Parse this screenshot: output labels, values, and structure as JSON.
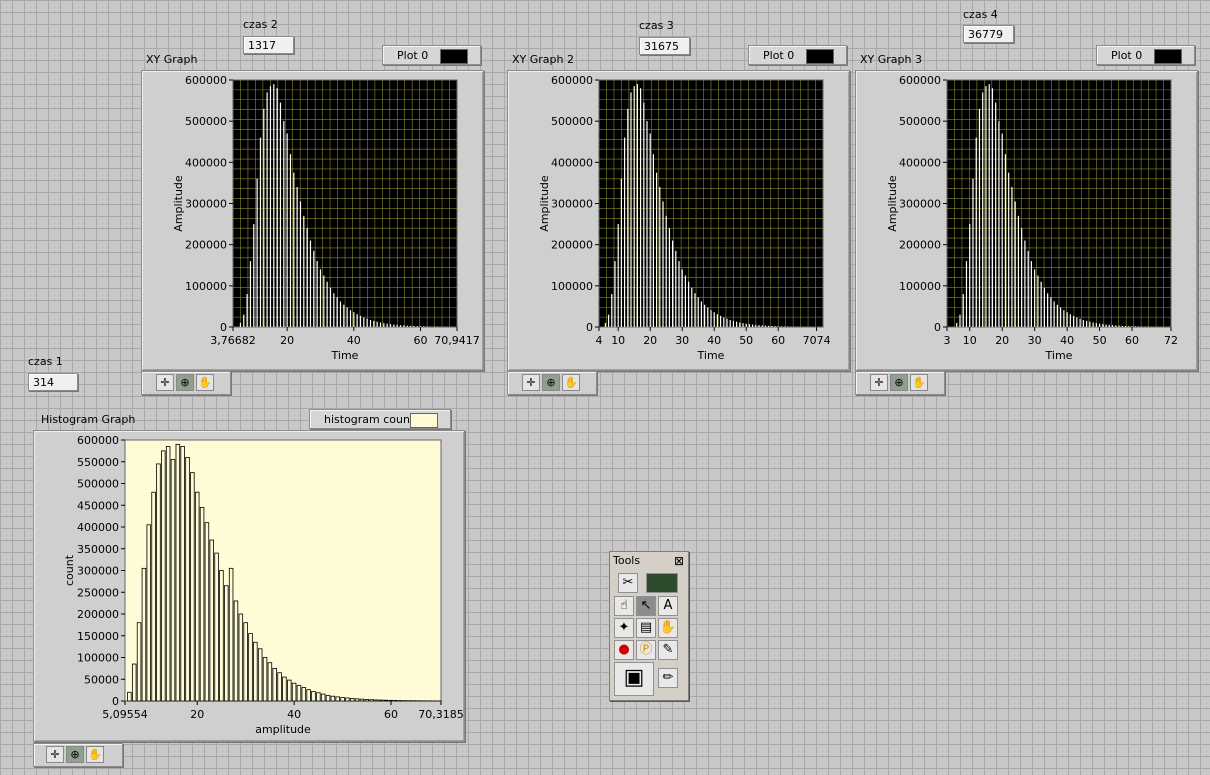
{
  "indicators": {
    "czas1": {
      "label": "czas 1",
      "value": "314"
    },
    "czas2": {
      "label": "czas 2",
      "value": "1317"
    },
    "czas3": {
      "label": "czas 3",
      "value": "31675"
    },
    "czas4": {
      "label": "czas 4",
      "value": "36779"
    }
  },
  "graphs": [
    {
      "title": "XY Graph",
      "legend": "Plot 0",
      "ylabel": "Amplitude",
      "xlabel": "Time",
      "yticks": [
        "600000",
        "500000",
        "400000",
        "300000",
        "200000",
        "100000",
        "0"
      ],
      "xticks": [
        "3,76682",
        "20",
        "40",
        "60",
        "70,9417"
      ],
      "xmin": 3.76682,
      "xmax": 70.9417
    },
    {
      "title": "XY Graph 2",
      "legend": "Plot 0",
      "ylabel": "Amplitude",
      "xlabel": "Time",
      "yticks": [
        "600000",
        "500000",
        "400000",
        "300000",
        "200000",
        "100000",
        "0"
      ],
      "xticks": [
        "4",
        "10",
        "20",
        "30",
        "40",
        "50",
        "60",
        "7074"
      ],
      "xmin": 4,
      "xmax": 74
    },
    {
      "title": "XY Graph 3",
      "legend": "Plot 0",
      "ylabel": "Amplitude",
      "xlabel": "Time",
      "yticks": [
        "600000",
        "500000",
        "400000",
        "300000",
        "200000",
        "100000",
        "0"
      ],
      "xticks": [
        "3",
        "10",
        "20",
        "30",
        "40",
        "50",
        "60",
        "72"
      ],
      "xmin": 3,
      "xmax": 72
    }
  ],
  "histogram": {
    "title": "Histogram Graph",
    "legend": "histogram count",
    "ylabel": "count",
    "xlabel": "amplitude",
    "yticks": [
      "600000",
      "550000",
      "500000",
      "450000",
      "400000",
      "350000",
      "300000",
      "250000",
      "200000",
      "150000",
      "100000",
      "50000",
      "0"
    ],
    "xticks": [
      "5,09554",
      "20",
      "40",
      "60",
      "70,3185"
    ],
    "xmin": 5.09554,
    "xmax": 70.3185
  },
  "palette_tools": [
    "cursor-tool",
    "zoom-tool",
    "pan-tool"
  ],
  "tools_window": {
    "title": "Tools",
    "close": "⊠"
  },
  "colors": {
    "plot_bg": "#000000",
    "plot_grid": "#8a8a2e",
    "hist_bg": "#fffbd6",
    "bar_white": "#ffffff"
  },
  "chart_data": [
    {
      "type": "bar",
      "title": "XY Graph",
      "xlabel": "Time",
      "ylabel": "Amplitude",
      "xlim": [
        3.76682,
        70.9417
      ],
      "ylim": [
        0,
        600000
      ],
      "grid": true,
      "x": [
        6,
        7,
        8,
        9,
        10,
        11,
        12,
        13,
        14,
        15,
        16,
        17,
        18,
        19,
        20,
        21,
        22,
        23,
        24,
        25,
        26,
        27,
        28,
        29,
        30,
        31,
        32,
        33,
        34,
        35,
        36,
        37,
        38,
        39,
        40,
        41,
        42,
        43,
        44,
        45,
        46,
        47,
        48,
        49,
        50,
        51,
        52,
        53,
        54,
        55,
        56,
        57,
        58,
        59,
        60,
        61,
        62,
        63,
        64,
        65,
        66,
        67,
        68,
        69,
        70
      ],
      "series": [
        {
          "values": [
            10000,
            30000,
            80000,
            160000,
            250000,
            360000,
            460000,
            530000,
            570000,
            585000,
            590000,
            580000,
            545000,
            500000,
            470000,
            420000,
            375000,
            340000,
            305000,
            270000,
            240000,
            210000,
            185000,
            160000,
            140000,
            125000,
            110000,
            95000,
            82000,
            72000,
            62000,
            54000,
            47000,
            41000,
            36000,
            31000,
            27000,
            23000,
            20000,
            17000,
            15000,
            13000,
            11000,
            9500,
            8200,
            7000,
            6000,
            5200,
            4500,
            3900,
            3300,
            2800,
            2400,
            2000,
            1700,
            1400,
            1200,
            1000,
            800,
            650,
            500,
            400,
            300,
            200,
            100
          ]
        }
      ]
    },
    {
      "type": "bar",
      "title": "XY Graph 2",
      "xlabel": "Time",
      "ylabel": "Amplitude",
      "xlim": [
        4,
        74
      ],
      "ylim": [
        0,
        600000
      ],
      "grid": true,
      "x": [
        6,
        7,
        8,
        9,
        10,
        11,
        12,
        13,
        14,
        15,
        16,
        17,
        18,
        19,
        20,
        21,
        22,
        23,
        24,
        25,
        26,
        27,
        28,
        29,
        30,
        31,
        32,
        33,
        34,
        35,
        36,
        37,
        38,
        39,
        40,
        41,
        42,
        43,
        44,
        45,
        46,
        47,
        48,
        49,
        50,
        51,
        52,
        53,
        54,
        55,
        56,
        57,
        58,
        59,
        60,
        61,
        62,
        63,
        64,
        65,
        66,
        67,
        68,
        69,
        70
      ],
      "series": [
        {
          "values": [
            10000,
            30000,
            80000,
            160000,
            250000,
            360000,
            460000,
            530000,
            570000,
            585000,
            590000,
            580000,
            545000,
            500000,
            470000,
            420000,
            375000,
            340000,
            305000,
            270000,
            240000,
            210000,
            185000,
            160000,
            140000,
            125000,
            110000,
            95000,
            82000,
            72000,
            62000,
            54000,
            47000,
            41000,
            36000,
            31000,
            27000,
            23000,
            20000,
            17000,
            15000,
            13000,
            11000,
            9500,
            8200,
            7000,
            6000,
            5200,
            4500,
            3900,
            3300,
            2800,
            2400,
            2000,
            1700,
            1400,
            1200,
            1000,
            800,
            650,
            500,
            400,
            300,
            200,
            100
          ]
        }
      ]
    },
    {
      "type": "bar",
      "title": "XY Graph 3",
      "xlabel": "Time",
      "ylabel": "Amplitude",
      "xlim": [
        3,
        72
      ],
      "ylim": [
        0,
        600000
      ],
      "grid": true,
      "x": [
        6,
        7,
        8,
        9,
        10,
        11,
        12,
        13,
        14,
        15,
        16,
        17,
        18,
        19,
        20,
        21,
        22,
        23,
        24,
        25,
        26,
        27,
        28,
        29,
        30,
        31,
        32,
        33,
        34,
        35,
        36,
        37,
        38,
        39,
        40,
        41,
        42,
        43,
        44,
        45,
        46,
        47,
        48,
        49,
        50,
        51,
        52,
        53,
        54,
        55,
        56,
        57,
        58,
        59,
        60,
        61,
        62,
        63,
        64,
        65,
        66,
        67,
        68,
        69,
        70
      ],
      "series": [
        {
          "values": [
            10000,
            30000,
            80000,
            160000,
            250000,
            360000,
            460000,
            530000,
            570000,
            585000,
            590000,
            580000,
            545000,
            500000,
            470000,
            420000,
            375000,
            340000,
            305000,
            270000,
            240000,
            210000,
            185000,
            160000,
            140000,
            125000,
            110000,
            95000,
            82000,
            72000,
            62000,
            54000,
            47000,
            41000,
            36000,
            31000,
            27000,
            23000,
            20000,
            17000,
            15000,
            13000,
            11000,
            9500,
            8200,
            7000,
            6000,
            5200,
            4500,
            3900,
            3300,
            2800,
            2400,
            2000,
            1700,
            1400,
            1200,
            1000,
            800,
            650,
            500,
            400,
            300,
            200,
            100
          ]
        }
      ]
    },
    {
      "type": "bar",
      "title": "Histogram Graph",
      "xlabel": "amplitude",
      "ylabel": "count",
      "xlim": [
        5.09554,
        70.3185
      ],
      "ylim": [
        0,
        600000
      ],
      "grid": false,
      "x": [
        6,
        7,
        8,
        9,
        10,
        11,
        12,
        13,
        14,
        15,
        16,
        17,
        18,
        19,
        20,
        21,
        22,
        23,
        24,
        25,
        26,
        27,
        28,
        29,
        30,
        31,
        32,
        33,
        34,
        35,
        36,
        37,
        38,
        39,
        40,
        41,
        42,
        43,
        44,
        45,
        46,
        47,
        48,
        49,
        50,
        51,
        52,
        53,
        54,
        55,
        56,
        57,
        58,
        59,
        60,
        61,
        62,
        63,
        64,
        65,
        66,
        67,
        68,
        69,
        70
      ],
      "series": [
        {
          "values": [
            20000,
            85000,
            180000,
            305000,
            405000,
            480000,
            545000,
            575000,
            585000,
            555000,
            590000,
            585000,
            560000,
            525000,
            480000,
            445000,
            410000,
            370000,
            340000,
            300000,
            265000,
            305000,
            230000,
            200000,
            180000,
            155000,
            135000,
            120000,
            100000,
            88000,
            75000,
            65000,
            55000,
            48000,
            41000,
            36000,
            31000,
            26000,
            22000,
            19000,
            16000,
            13000,
            11000,
            9500,
            8000,
            7000,
            6000,
            5000,
            4200,
            3600,
            3000,
            2500,
            2100,
            1800,
            1500,
            1200,
            1000,
            800,
            700,
            600,
            500,
            400,
            300,
            200,
            100
          ]
        }
      ]
    }
  ]
}
